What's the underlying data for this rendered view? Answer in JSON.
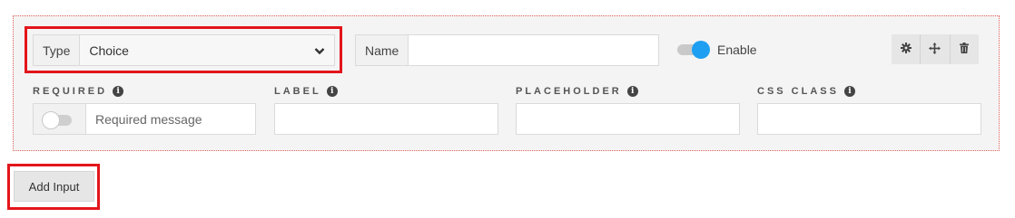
{
  "row1": {
    "type_label": "Type",
    "type_value": "Choice",
    "name_label": "Name",
    "name_value": "",
    "enable_label": "Enable",
    "enable_on": true
  },
  "labels": {
    "required": "REQUIRED",
    "label": "LABEL",
    "placeholder": "PLACEHOLDER",
    "css_class": "CSS CLASS"
  },
  "required": {
    "on": false,
    "message_placeholder": "Required message"
  },
  "tools": [
    "gear-icon",
    "move-icon",
    "trash-icon"
  ],
  "add_input_label": "Add Input",
  "colors": {
    "accent": "#1e9ff2",
    "highlight": "#e3151b",
    "panel_border": "#e0605a"
  }
}
